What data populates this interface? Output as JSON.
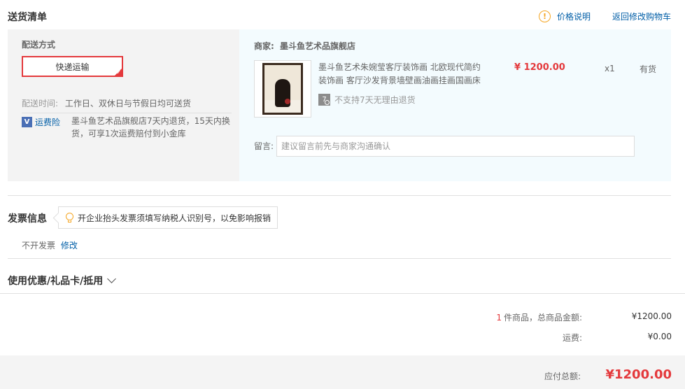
{
  "delivery": {
    "title": "送货清单",
    "price_info_icon": "!",
    "price_info_label": "价格说明",
    "back_to_cart_label": "返回修改购物车",
    "shipping_method_title": "配送方式",
    "shipping_method_option": "快递运输",
    "delivery_time_label": "配送时间:",
    "delivery_time_value": "工作日、双休日与节假日均可送货",
    "insurance_icon": "V",
    "insurance_label": "运费险",
    "insurance_desc": "墨斗鱼艺术品旗舰店7天内退货，15天内换货，可享1次运费赔付到小金库"
  },
  "merchant": {
    "label": "商家:",
    "name": "墨斗鱼艺术品旗舰店",
    "product": {
      "name": "墨斗鱼艺术朱婉莹客厅装饰画 北欧现代简约装饰画 客厅沙发背景墙壁画油画挂画国画床",
      "price": "¥ 1200.00",
      "quantity": "x1",
      "stock": "有货",
      "return_badge": "7",
      "return_policy": "不支持7天无理由退货"
    },
    "message_label": "留言:",
    "message_placeholder": "建议留言前先与商家沟通确认"
  },
  "invoice": {
    "title": "发票信息",
    "tip": "开企业抬头发票须填写纳税人识别号，以免影响报销",
    "status": "不开发票",
    "edit_label": "修改"
  },
  "coupon": {
    "title": "使用优惠/礼品卡/抵用"
  },
  "summary": {
    "item_count": "1",
    "item_count_suffix": "件商品，总商品金额:",
    "goods_total": "¥1200.00",
    "shipping_label": "运费:",
    "shipping_fee": "¥0.00",
    "payable_label": "应付总额:",
    "payable_total": "¥1200.00"
  },
  "colors": {
    "accent_red": "#e4393c",
    "link_blue": "#005ea7",
    "warn_orange": "#f5a623"
  }
}
